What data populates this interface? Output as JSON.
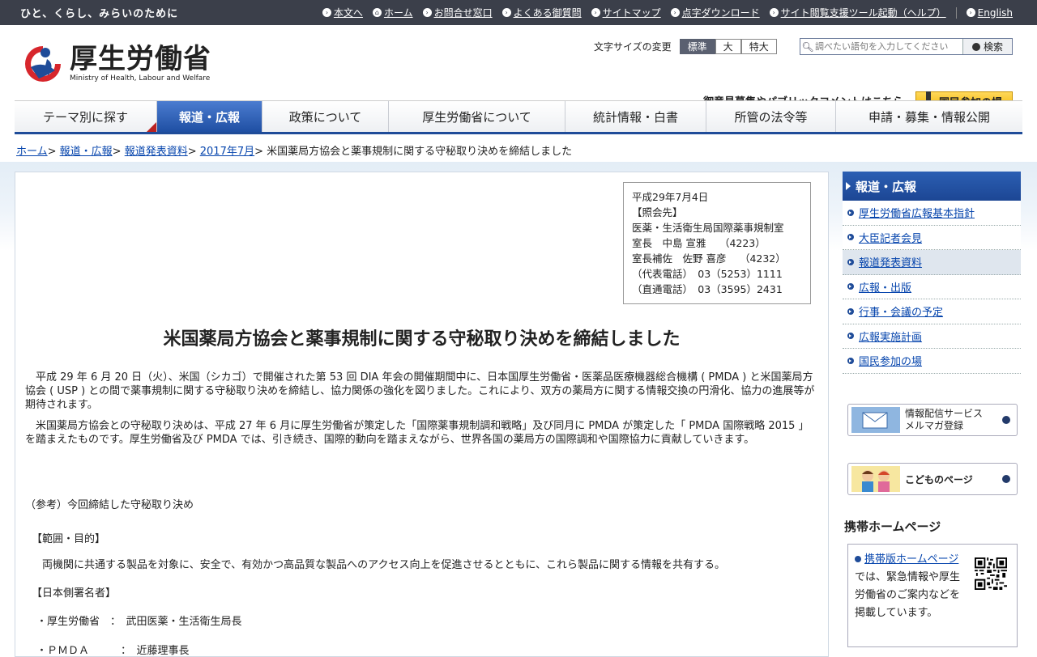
{
  "topbar": {
    "tagline": "ひと、くらし、みらいのために",
    "links": [
      {
        "label": "本文へ"
      },
      {
        "label": "ホーム"
      },
      {
        "label": "お問合せ窓口"
      },
      {
        "label": "よくある御質問"
      },
      {
        "label": "サイトマップ"
      },
      {
        "label": "点字ダウンロード"
      },
      {
        "label": "サイト閲覧支援ツール起動（ヘルプ）"
      }
    ],
    "english": "English"
  },
  "header": {
    "logo_title": "厚生労働省",
    "logo_en": "Ministry of Health, Labour and Welfare",
    "font_size_label": "文字サイズの変更",
    "font_sizes": [
      "標準",
      "大",
      "特大"
    ],
    "search_placeholder": "調べたい語句を入力してください",
    "search_button": "検索",
    "public_comment": "御意見募集やパブリックコメントはこちら",
    "participate": "国民参加の場"
  },
  "nav": [
    {
      "label": "テーマ別に探す"
    },
    {
      "label": "報道・広報"
    },
    {
      "label": "政策について"
    },
    {
      "label": "厚生労働省について"
    },
    {
      "label": "統計情報・白書"
    },
    {
      "label": "所管の法令等"
    },
    {
      "label": "申請・募集・情報公開"
    }
  ],
  "breadcrumb": {
    "items": [
      "ホーム",
      "報道・広報",
      "報道発表資料",
      "2017年7月"
    ],
    "current": "米国薬局方協会と薬事規制に関する守秘取り決めを締結しました"
  },
  "contact": {
    "text": "平成29年7月4日\n【照会先】\n医薬・生活衛生局国際薬事規制室\n室長　中島 宣雅　 （4223）\n室長補佐　佐野 喜彦　 （4232）\n（代表電話）　03（5253）1111\n（直通電話）　03（3595）2431"
  },
  "article": {
    "title": "米国薬局方協会と薬事規制に関する守秘取り決めを締結しました",
    "para1": "　平成 29 年 6 月 20 日（火）、米国（シカゴ）で開催された第 53 回 DIA 年会の開催期間中に、日本国厚生労働省・医薬品医療機器総合機構 ( PMDA ) と米国薬局方協会 ( USP ) との間で薬事規制に関する守秘取り決めを締結し、協力関係の強化を図りました。これにより、双方の薬局方に関する情報交換の円滑化、協力の進展等が期待されます。",
    "para2": "　米国薬局方協会との守秘取り決めは、平成 27 年 6 月に厚生労働省が策定した「国際薬事規制調和戦略」及び同月に PMDA が策定した「 PMDA 国際戦略 2015 」を踏まえたものです。厚生労働省及び PMDA では、引き続き、国際的動向を踏まえながら、世界各国の薬局方の国際調和や国際協力に貢献していきます。",
    "ref": "（参考）今回締結した守秘取り決め",
    "scope_head": "【範囲・目的】",
    "scope": "　両機関に共通する製品を対象に、安全で、有効かつ高品質な製品へのアクセス向上を促進させるとともに、これら製品に関する情報を共有する。",
    "signers_head": "【日本側署名者】",
    "signer1": "・厚生労働省　：　武田医薬・生活衛生局長",
    "signer2": "・ＰＭＤＡ　　　：　近藤理事長"
  },
  "sidebar": {
    "head": "報道・広報",
    "items": [
      {
        "label": "厚生労働省広報基本指針"
      },
      {
        "label": "大臣記者会見"
      },
      {
        "label": "報道発表資料"
      },
      {
        "label": "広報・出版"
      },
      {
        "label": "行事・会議の予定"
      },
      {
        "label": "広報実施計画"
      },
      {
        "label": "国民参加の場"
      }
    ],
    "banner1": "情報配信サービス\nメルマガ登録",
    "banner2": "こどものページ",
    "mobile_title": "携帯ホームページ",
    "mobile_link": "携帯版ホームページ",
    "mobile_text": "では、緊急情報や厚生労働省のご案内などを掲載しています。"
  }
}
